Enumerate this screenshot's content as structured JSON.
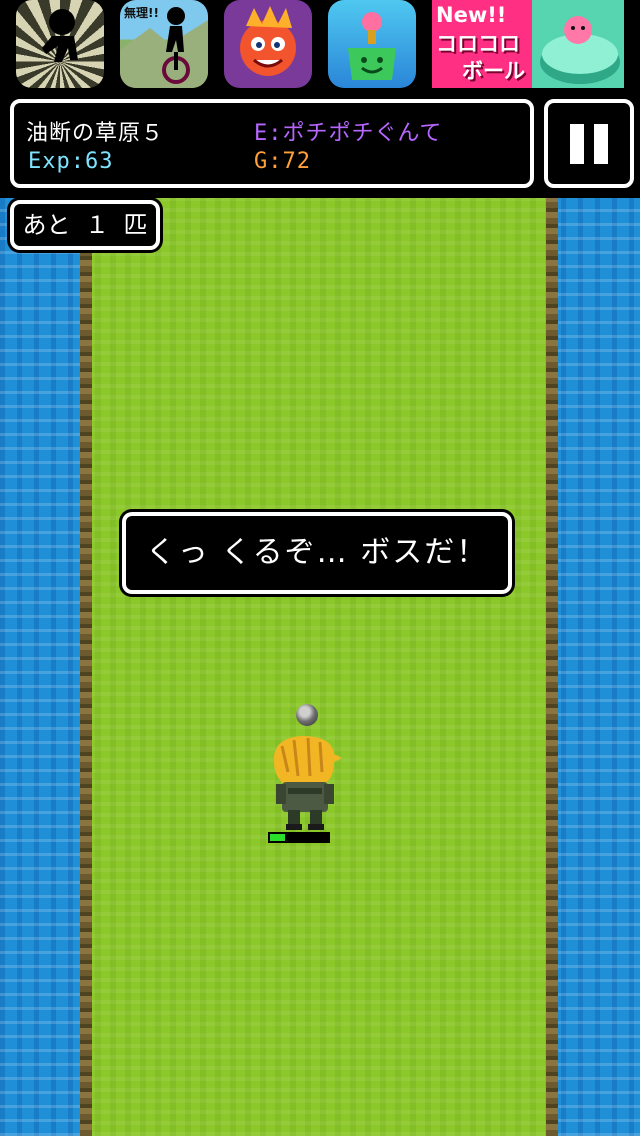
{
  "ads": [
    {
      "id": "ad1",
      "icon": "running-silhouette-icon"
    },
    {
      "id": "ad2",
      "icon": "unicycle-silhouette-icon",
      "caption": "無理!!"
    },
    {
      "id": "ad3",
      "icon": "red-dragon-icon"
    },
    {
      "id": "ad4",
      "icon": "green-watering-can-icon"
    },
    {
      "id": "ad5",
      "icon": "pink-ball-icon",
      "line1": "New!!",
      "line2": "コロコロ",
      "line3": "ボール"
    }
  ],
  "status": {
    "stage_name": "油断の草原５",
    "enemy_name": "E:ポチポチぐんて",
    "exp": "Exp:63",
    "gold": "G:72"
  },
  "pause": {
    "icon": "pause-icon"
  },
  "remaining": {
    "text": "あと １ 匹"
  },
  "message": {
    "text": "くっ くるぞ… ボスだ！"
  },
  "hero": {
    "hp_fraction": 0.25
  },
  "colors": {
    "grass": "#8cc82a",
    "water": "#1f8fd8",
    "enemy_text": "#b766ff",
    "exp_text": "#7fe3ff",
    "gold_text": "#ffa03a",
    "hp": "#2ae02a"
  }
}
